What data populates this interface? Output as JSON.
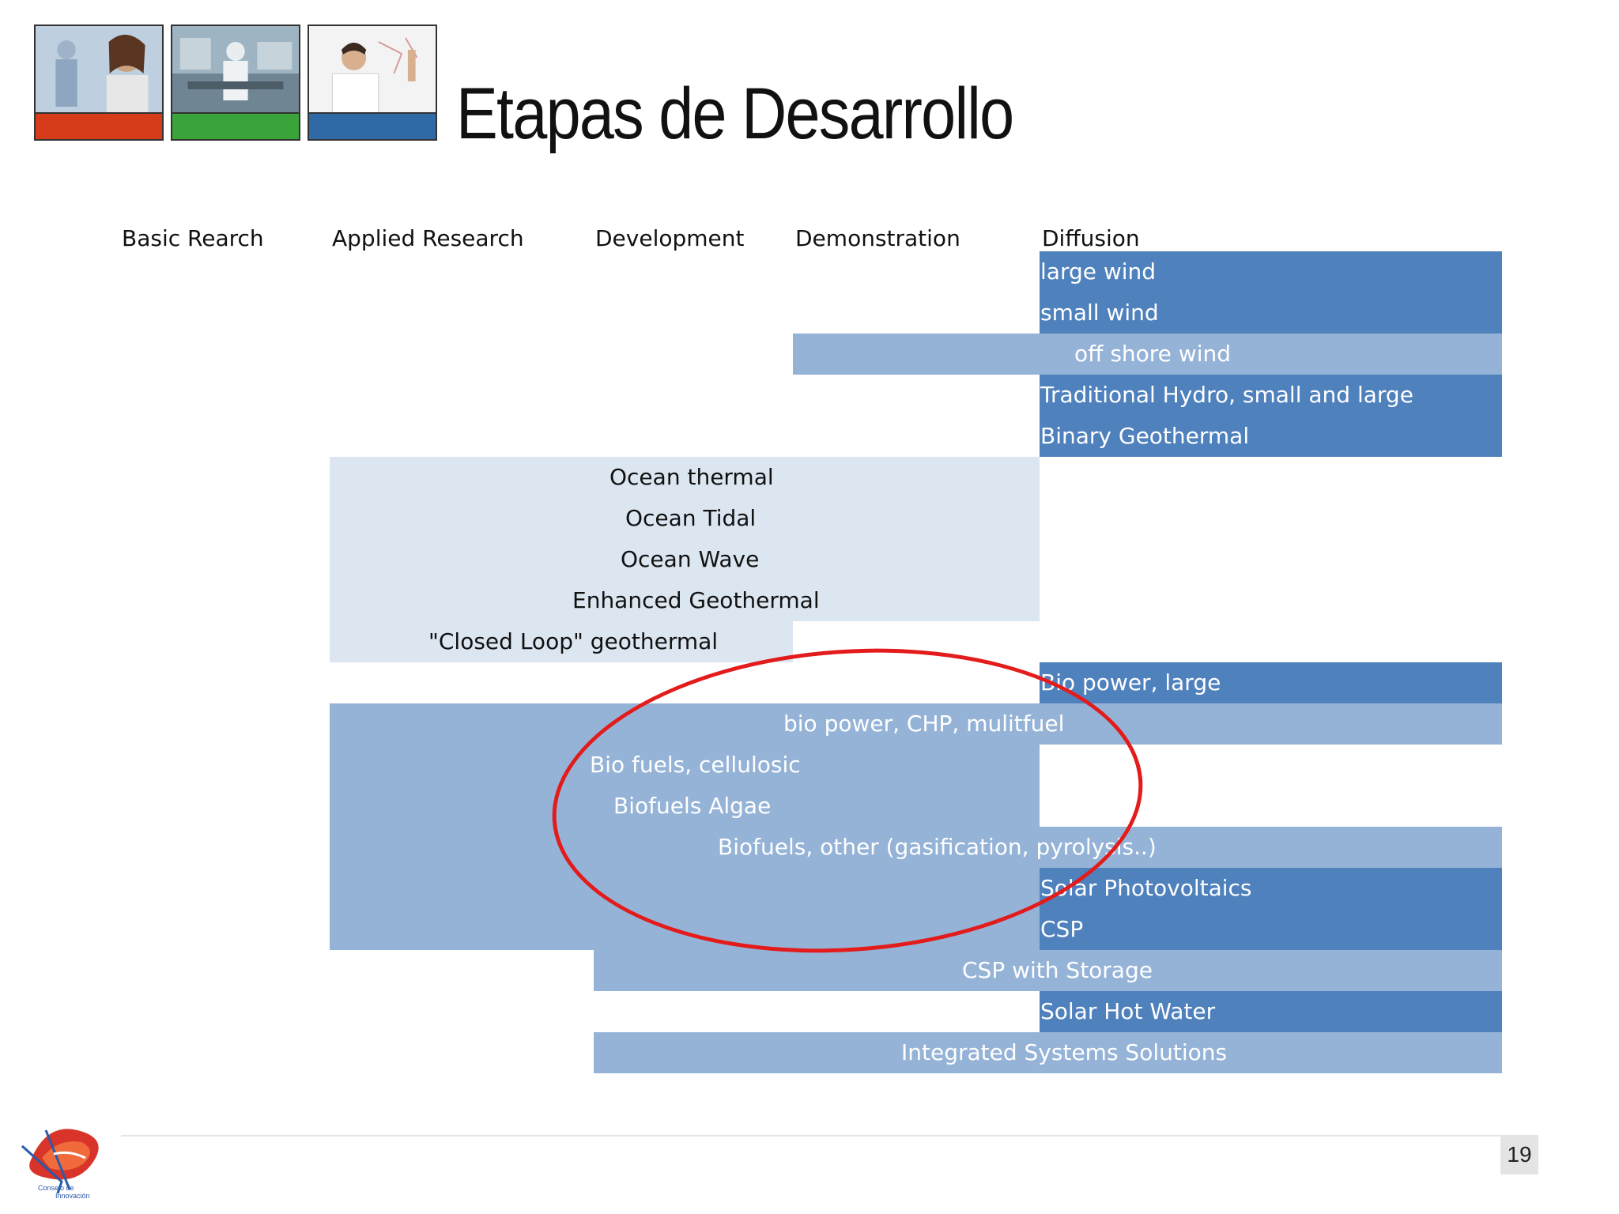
{
  "title": "Etapas de Desarrollo",
  "colors": {
    "dark_blue": "#4f81bd",
    "medium_blue": "#95b3d7",
    "light_blue": "#dce6f1",
    "highlight_ellipse": "#e31b1b",
    "thumb_red": "#d63c1a",
    "thumb_green": "#3aa33a",
    "thumb_blue": "#2f69a6"
  },
  "columns": [
    "Basic Rearch",
    "Applied Research",
    "Development",
    "Demonstration",
    "Diffusion"
  ],
  "technologies": [
    {
      "name": "large wind",
      "start_stage": "Diffusion",
      "end_stage": "Diffusion",
      "shade": "dark"
    },
    {
      "name": "small wind",
      "start_stage": "Diffusion",
      "end_stage": "Diffusion",
      "shade": "dark"
    },
    {
      "name": "off shore wind",
      "start_stage": "Demonstration",
      "end_stage": "Diffusion",
      "shade": "medium"
    },
    {
      "name": "Traditional Hydro, small and large",
      "start_stage": "Diffusion",
      "end_stage": "Diffusion",
      "shade": "dark"
    },
    {
      "name": "Binary Geothermal",
      "start_stage": "Diffusion",
      "end_stage": "Diffusion",
      "shade": "dark"
    },
    {
      "name": "Ocean thermal",
      "start_stage": "Applied Research",
      "end_stage": "Demonstration",
      "shade": "light"
    },
    {
      "name": "Ocean Tidal",
      "start_stage": "Applied Research",
      "end_stage": "Demonstration",
      "shade": "light"
    },
    {
      "name": "Ocean Wave",
      "start_stage": "Applied Research",
      "end_stage": "Demonstration",
      "shade": "light"
    },
    {
      "name": "Enhanced Geothermal",
      "start_stage": "Applied Research",
      "end_stage": "Demonstration",
      "shade": "light"
    },
    {
      "name": "\"Closed Loop\" geothermal",
      "start_stage": "Applied Research",
      "end_stage": "Development",
      "shade": "light"
    },
    {
      "name": "Bio power, large",
      "start_stage": "Diffusion",
      "end_stage": "Diffusion",
      "shade": "dark"
    },
    {
      "name": "bio power, CHP, mulitfuel",
      "start_stage": "Applied Research",
      "end_stage": "Diffusion",
      "shade": "medium"
    },
    {
      "name": "Bio fuels, cellulosic",
      "start_stage": "Applied Research",
      "end_stage": "Demonstration",
      "shade": "medium"
    },
    {
      "name": "Biofuels Algae",
      "start_stage": "Applied Research",
      "end_stage": "Demonstration",
      "shade": "medium"
    },
    {
      "name": "Biofuels, other (gasification, pyrolysis..)",
      "start_stage": "Applied Research",
      "end_stage": "Diffusion",
      "shade": "medium"
    },
    {
      "name": "Solar Photovoltaics",
      "start_stage": "Diffusion",
      "end_stage": "Diffusion",
      "shade": "dark"
    },
    {
      "name": "CSP",
      "start_stage": "Diffusion",
      "end_stage": "Diffusion",
      "shade": "dark"
    },
    {
      "name": "CSP with Storage",
      "start_stage": "Development",
      "end_stage": "Diffusion",
      "shade": "medium"
    },
    {
      "name": "Solar Hot Water",
      "start_stage": "Diffusion",
      "end_stage": "Diffusion",
      "shade": "dark"
    },
    {
      "name": "Integrated Systems Solutions",
      "start_stage": "Development",
      "end_stage": "Diffusion",
      "shade": "medium"
    }
  ],
  "logo_text": "Consejo de Innovación",
  "page_number": "19"
}
